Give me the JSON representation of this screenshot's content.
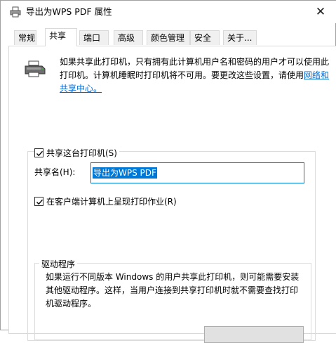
{
  "window": {
    "title": "导出为WPS PDF 属性",
    "close_glyph": "✕"
  },
  "tabs": [
    {
      "label": "常规",
      "active": false
    },
    {
      "label": "共享",
      "active": true
    },
    {
      "label": "端口",
      "active": false
    },
    {
      "label": "高级",
      "active": false
    },
    {
      "label": "颜色管理",
      "active": false
    },
    {
      "label": "安全",
      "active": false
    },
    {
      "label": "关于...",
      "active": false
    }
  ],
  "info": {
    "text": "如果共享此打印机，只有拥有此计算机用户名和密码的用户才可以使用此打印机。计算机睡眠时打印机将不可用。要更改这些设置，请使用",
    "link": "网络和共享中心。"
  },
  "share": {
    "checkbox_label": "共享这台打印机(S)",
    "checked": true,
    "name_label": "共享名(H):",
    "name_value": "导出为WPS PDF"
  },
  "render": {
    "checkbox_label": "在客户端计算机上呈现打印作业(R)",
    "checked": true
  },
  "driver": {
    "legend": "驱动程序",
    "text": "如果运行不同版本 Windows 的用户共享此打印机，则可能需要安装其他驱动程序。这样，当用户连接到共享打印机时就不需要查找打印机驱动程序。"
  },
  "colors": {
    "accent": "#0078d7",
    "link": "#0066cc"
  },
  "icons": {
    "title": "printer-icon",
    "info": "printer-icon",
    "close": "close-icon",
    "check": "checkmark-icon"
  }
}
